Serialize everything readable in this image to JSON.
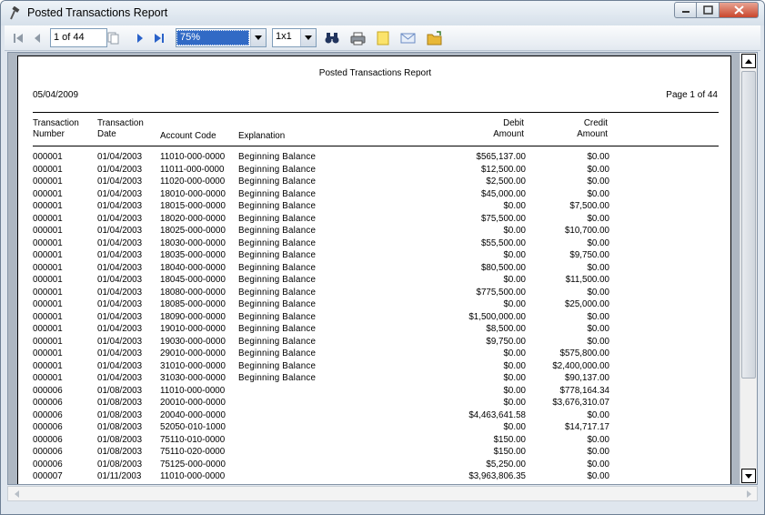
{
  "window": {
    "title": "Posted Transactions Report"
  },
  "toolbar": {
    "page_value": "1 of 44",
    "zoom_value": "75%",
    "layout_value": "1x1"
  },
  "report": {
    "title": "Posted Transactions Report",
    "date": "05/04/2009",
    "page_info": "Page 1 of 44",
    "headers": {
      "trans_num_1": "Transaction",
      "trans_num_2": "Number",
      "trans_date_1": "Transaction",
      "trans_date_2": "Date",
      "account": "Account Code",
      "explanation": "Explanation",
      "debit_1": "Debit",
      "debit_2": "Amount",
      "credit_1": "Credit",
      "credit_2": "Amount"
    },
    "rows": [
      {
        "num": "000001",
        "date": "01/04/2003",
        "acct": "11010-000-0000",
        "exp": "Beginning Balance",
        "debit": "$565,137.00",
        "credit": "$0.00"
      },
      {
        "num": "000001",
        "date": "01/04/2003",
        "acct": "11011-000-0000",
        "exp": "Beginning Balance",
        "debit": "$12,500.00",
        "credit": "$0.00"
      },
      {
        "num": "000001",
        "date": "01/04/2003",
        "acct": "11020-000-0000",
        "exp": "Beginning Balance",
        "debit": "$2,500.00",
        "credit": "$0.00"
      },
      {
        "num": "000001",
        "date": "01/04/2003",
        "acct": "18010-000-0000",
        "exp": "Beginning Balance",
        "debit": "$45,000.00",
        "credit": "$0.00"
      },
      {
        "num": "000001",
        "date": "01/04/2003",
        "acct": "18015-000-0000",
        "exp": "Beginning Balance",
        "debit": "$0.00",
        "credit": "$7,500.00"
      },
      {
        "num": "000001",
        "date": "01/04/2003",
        "acct": "18020-000-0000",
        "exp": "Beginning Balance",
        "debit": "$75,500.00",
        "credit": "$0.00"
      },
      {
        "num": "000001",
        "date": "01/04/2003",
        "acct": "18025-000-0000",
        "exp": "Beginning Balance",
        "debit": "$0.00",
        "credit": "$10,700.00"
      },
      {
        "num": "000001",
        "date": "01/04/2003",
        "acct": "18030-000-0000",
        "exp": "Beginning Balance",
        "debit": "$55,500.00",
        "credit": "$0.00"
      },
      {
        "num": "000001",
        "date": "01/04/2003",
        "acct": "18035-000-0000",
        "exp": "Beginning Balance",
        "debit": "$0.00",
        "credit": "$9,750.00"
      },
      {
        "num": "000001",
        "date": "01/04/2003",
        "acct": "18040-000-0000",
        "exp": "Beginning Balance",
        "debit": "$80,500.00",
        "credit": "$0.00"
      },
      {
        "num": "000001",
        "date": "01/04/2003",
        "acct": "18045-000-0000",
        "exp": "Beginning Balance",
        "debit": "$0.00",
        "credit": "$11,500.00"
      },
      {
        "num": "000001",
        "date": "01/04/2003",
        "acct": "18080-000-0000",
        "exp": "Beginning Balance",
        "debit": "$775,500.00",
        "credit": "$0.00"
      },
      {
        "num": "000001",
        "date": "01/04/2003",
        "acct": "18085-000-0000",
        "exp": "Beginning Balance",
        "debit": "$0.00",
        "credit": "$25,000.00"
      },
      {
        "num": "000001",
        "date": "01/04/2003",
        "acct": "18090-000-0000",
        "exp": "Beginning Balance",
        "debit": "$1,500,000.00",
        "credit": "$0.00"
      },
      {
        "num": "000001",
        "date": "01/04/2003",
        "acct": "19010-000-0000",
        "exp": "Beginning Balance",
        "debit": "$8,500.00",
        "credit": "$0.00"
      },
      {
        "num": "000001",
        "date": "01/04/2003",
        "acct": "19030-000-0000",
        "exp": "Beginning Balance",
        "debit": "$9,750.00",
        "credit": "$0.00"
      },
      {
        "num": "000001",
        "date": "01/04/2003",
        "acct": "29010-000-0000",
        "exp": "Beginning Balance",
        "debit": "$0.00",
        "credit": "$575,800.00"
      },
      {
        "num": "000001",
        "date": "01/04/2003",
        "acct": "31010-000-0000",
        "exp": "Beginning Balance",
        "debit": "$0.00",
        "credit": "$2,400,000.00"
      },
      {
        "num": "000001",
        "date": "01/04/2003",
        "acct": "31030-000-0000",
        "exp": "Beginning Balance",
        "debit": "$0.00",
        "credit": "$90,137.00"
      },
      {
        "num": "000006",
        "date": "01/08/2003",
        "acct": "11010-000-0000",
        "exp": "",
        "debit": "$0.00",
        "credit": "$778,164.34"
      },
      {
        "num": "000006",
        "date": "01/08/2003",
        "acct": "20010-000-0000",
        "exp": "",
        "debit": "$0.00",
        "credit": "$3,676,310.07"
      },
      {
        "num": "000006",
        "date": "01/08/2003",
        "acct": "20040-000-0000",
        "exp": "",
        "debit": "$4,463,641.58",
        "credit": "$0.00"
      },
      {
        "num": "000006",
        "date": "01/08/2003",
        "acct": "52050-010-1000",
        "exp": "",
        "debit": "$0.00",
        "credit": "$14,717.17"
      },
      {
        "num": "000006",
        "date": "01/08/2003",
        "acct": "75110-010-0000",
        "exp": "",
        "debit": "$150.00",
        "credit": "$0.00"
      },
      {
        "num": "000006",
        "date": "01/08/2003",
        "acct": "75110-020-0000",
        "exp": "",
        "debit": "$150.00",
        "credit": "$0.00"
      },
      {
        "num": "000006",
        "date": "01/08/2003",
        "acct": "75125-000-0000",
        "exp": "",
        "debit": "$5,250.00",
        "credit": "$0.00"
      },
      {
        "num": "000007",
        "date": "01/11/2003",
        "acct": "11010-000-0000",
        "exp": "",
        "debit": "$3,963,806.35",
        "credit": "$0.00"
      }
    ]
  },
  "icons": {
    "first": "first-page-icon",
    "prev": "prev-page-icon",
    "multi": "multi-page-icon",
    "next": "next-page-icon",
    "last": "last-page-icon",
    "find": "binoculars-icon",
    "print": "printer-icon",
    "export": "note-icon",
    "email": "envelope-icon",
    "open": "folder-icon"
  }
}
